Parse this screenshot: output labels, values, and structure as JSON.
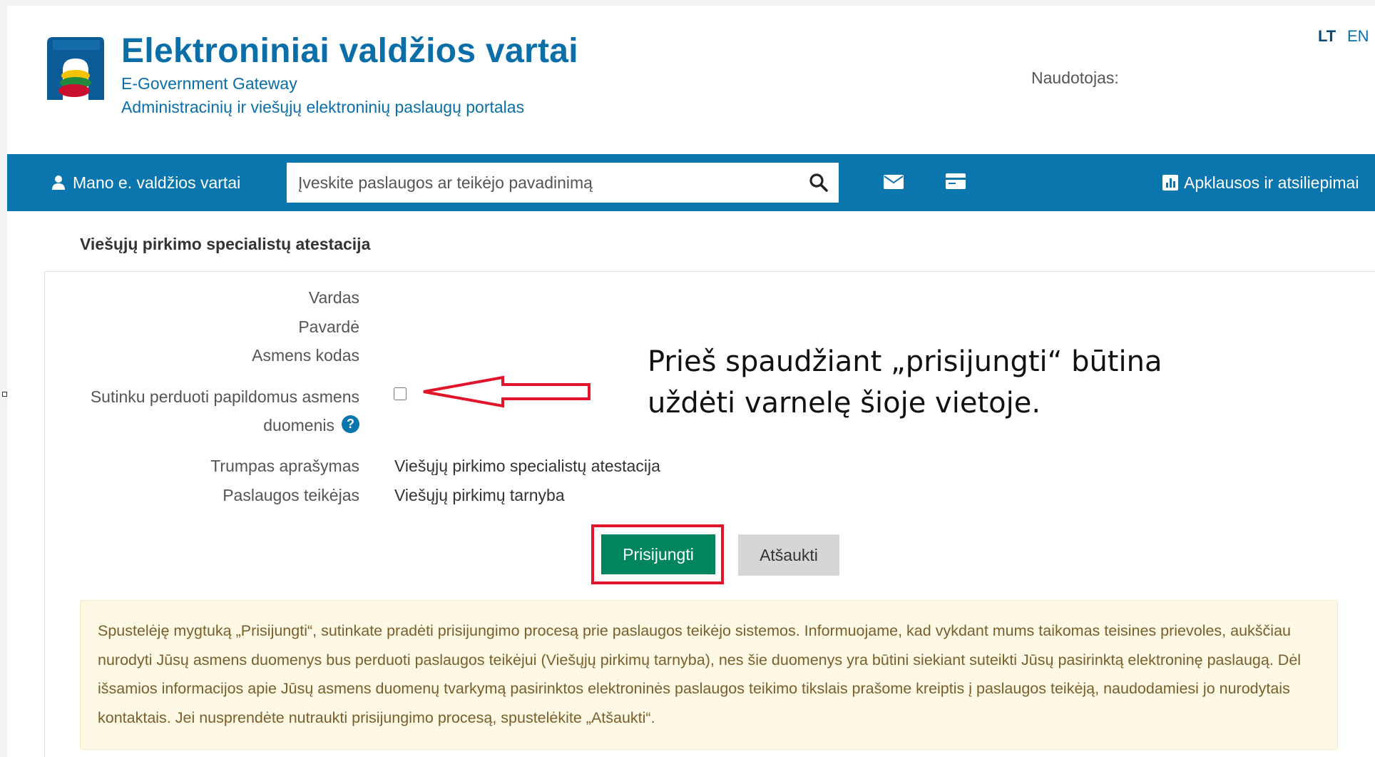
{
  "header": {
    "title": "Elektroniniai valdžios vartai",
    "subtitle_en": "E-Government Gateway",
    "subtitle_lt": "Administracinių ir viešųjų elektroninių paslaugų portalas",
    "user_label": "Naudotojas:",
    "lang_lt": "LT",
    "lang_en": "EN"
  },
  "nav": {
    "my_portal": "Mano e. valdžios vartai",
    "search_placeholder": "Įveskite paslaugos ar teikėjo pavadinimą",
    "surveys": "Apklausos ir atsiliepimai"
  },
  "panel": {
    "title": "Viešųjų pirkimo specialistų atestacija",
    "fields": {
      "first_name": "Vardas",
      "last_name": "Pavardė",
      "personal_code": "Asmens kodas",
      "consent_line1": "Sutinku perduoti papildomus asmens",
      "consent_line2": "duomenis",
      "help": "?",
      "short_desc_label": "Trumpas aprašymas",
      "short_desc_value": "Viešųjų pirkimo specialistų atestacija",
      "provider_label": "Paslaugos teikėjas",
      "provider_value": "Viešųjų pirkimų tarnyba"
    },
    "buttons": {
      "login": "Prisijungti",
      "cancel": "Atšaukti"
    },
    "notice": "Spustelėję mygtuką „Prisijungti“, sutinkate pradėti prisijungimo procesą prie paslaugos teikėjo sistemos. Informuojame, kad vykdant mums taikomas teisines prievoles, aukščiau nurodyti Jūsų asmens duomenys bus perduoti paslaugos teikėjui (Viešųjų pirkimų tarnyba), nes šie duomenys yra būtini siekiant suteikti Jūsų pasirinktą elektroninę paslaugą. Dėl išsamios informacijos apie Jūsų asmens duomenų tvarkymą pasirinktos elektroninės paslaugos teikimo tikslais prašome kreiptis į paslaugos teikėją, naudodamiesi jo nurodytais kontaktais. Jei nusprendėte nutraukti prisijungimo procesą, spustelėkite „Atšaukti“."
  },
  "annotation": {
    "line1": "Prieš spaudžiant „prisijungti“ būtina",
    "line2": "uždėti varnelę šioje vietoje."
  },
  "colors": {
    "brand_blue": "#0b75ad",
    "login_green": "#00855f",
    "highlight_red": "#e2142b",
    "notice_bg": "#fcf8e3"
  },
  "icons": [
    "logo-icon",
    "user-icon",
    "search-icon",
    "mail-icon",
    "card-icon",
    "chart-icon",
    "help-icon",
    "arrow-icon"
  ]
}
